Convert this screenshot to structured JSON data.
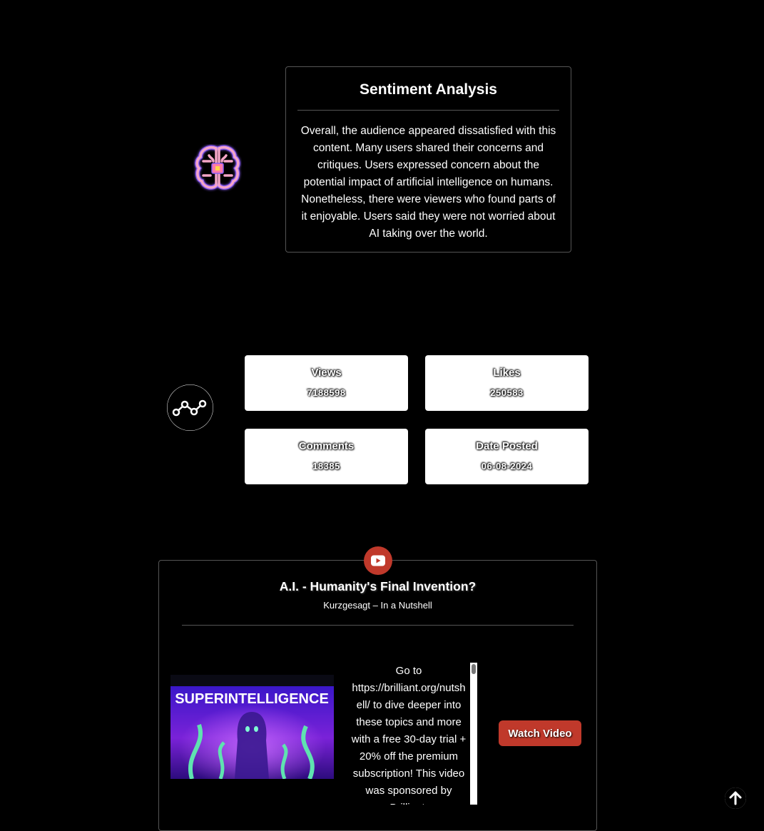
{
  "sentiment": {
    "title": "Sentiment Analysis",
    "text": "Overall, the audience appeared dissatisfied with this content. Many users shared their concerns and critiques. Users expressed concern about the potential impact of artificial intelligence on humans. Nonetheless, there were viewers who found parts of it enjoyable. Users said they were not worried about AI taking over the world.",
    "icon": "brain-chip-icon"
  },
  "stats": {
    "icon": "analytics-icon",
    "views": {
      "label": "Views",
      "value": "7188598"
    },
    "likes": {
      "label": "Likes",
      "value": "250583"
    },
    "comments": {
      "label": "Comments",
      "value": "18385"
    },
    "date": {
      "label": "Date Posted",
      "value": "06-08-2024"
    }
  },
  "video": {
    "icon": "youtube-icon",
    "title": "A.I. - Humanity's Final Invention?",
    "channel": "Kurzgesagt – In a Nutshell",
    "thumbnail_text": "SUPERINTELLIGENCE",
    "description": "Go to https://brilliant.org/nutshell/ to dive deeper into these topics and more with a free 30-day trial + 20% off the premium subscription! This video was sponsored by Brilliant.",
    "watch_label": "Watch Video"
  },
  "scroll_top_icon": "arrow-up-icon",
  "colors": {
    "background": "#000000",
    "accent_red": "#c0392b",
    "card_white": "#ffffff"
  }
}
